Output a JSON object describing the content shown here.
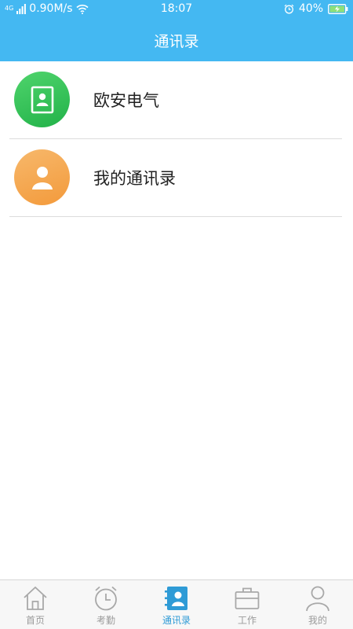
{
  "status_bar": {
    "network_type": "4G",
    "speed": "0.90M/s",
    "time": "18:07",
    "battery": "40%"
  },
  "header": {
    "title": "通讯录"
  },
  "contacts": {
    "items": [
      {
        "label": "欧安电气",
        "icon": "contact-book-icon",
        "color": "#2fc052"
      },
      {
        "label": "我的通讯录",
        "icon": "person-icon",
        "color": "#f5a34b"
      }
    ]
  },
  "tabbar": {
    "active_color": "#2f9bd6",
    "items": [
      {
        "label": "首页",
        "icon": "home-icon",
        "active": false
      },
      {
        "label": "考勤",
        "icon": "alarm-clock-icon",
        "active": false
      },
      {
        "label": "通讯录",
        "icon": "contacts-icon",
        "active": true
      },
      {
        "label": "工作",
        "icon": "briefcase-icon",
        "active": false
      },
      {
        "label": "我的",
        "icon": "user-icon",
        "active": false
      }
    ]
  },
  "colors": {
    "primary": "#44b8f2",
    "divider": "#dcdcdc"
  }
}
